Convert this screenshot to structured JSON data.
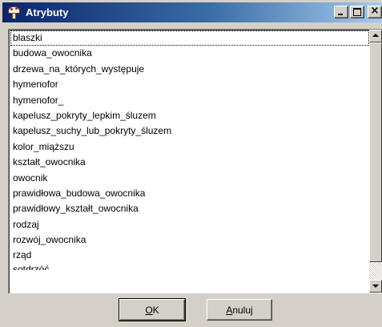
{
  "window": {
    "title": "Atrybuty",
    "close_glyph": "×"
  },
  "list": {
    "items": [
      "blaszki",
      "budowa_owocnika",
      "drzewa_na_których_występuje",
      "hymenofor",
      "hymenofor_",
      "kapelusz_pokryty_lepkim_śluzem",
      "kapelusz_suchy_lub_pokryty_śluzem",
      "kolor_miąższu",
      "kształt_owocnika",
      "owocnik",
      "prawidłowa_budowa_owocnika",
      "prawidłowy_kształt_owocnika",
      "rodzaj",
      "rozwój_owocnika",
      "rząd",
      "sotdrzóć"
    ],
    "selected_index": 0
  },
  "buttons": {
    "ok_accel": "O",
    "ok_rest": "K",
    "cancel_accel": "A",
    "cancel_rest": "nuluj"
  }
}
